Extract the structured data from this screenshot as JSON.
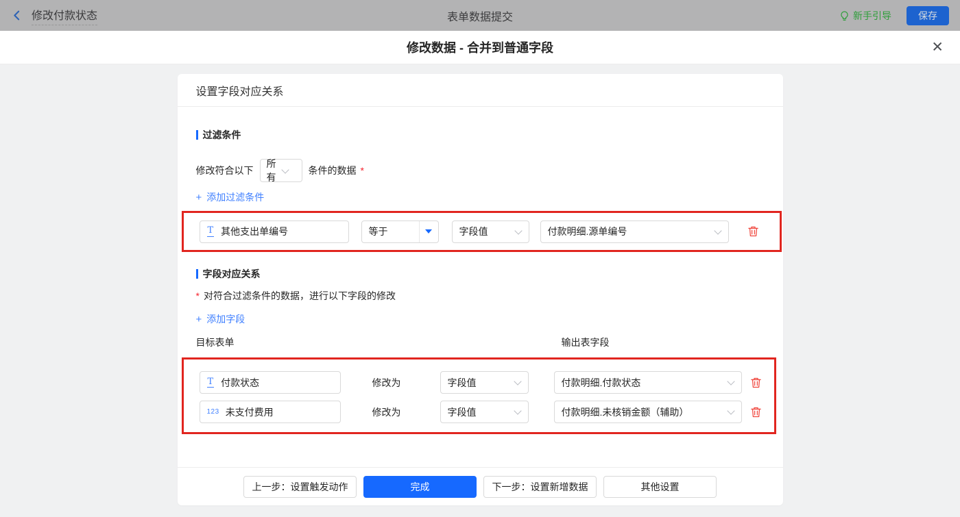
{
  "topbar": {
    "back_label": "修改付款状态",
    "center_title": "表单数据提交",
    "guide_label": "新手引导",
    "save_label": "保存"
  },
  "dialog": {
    "title": "修改数据 - 合并到普通字段",
    "close_glyph": "✕"
  },
  "card": {
    "header_title": "设置字段对应关系"
  },
  "filter": {
    "section_title": "过滤条件",
    "match_prefix": "修改符合以下",
    "match_value": "所有",
    "match_suffix": "条件的数据",
    "required_mark": "*",
    "plus": "+",
    "add_label": "添加过滤条件",
    "row": {
      "field_icon": "T",
      "field": "其他支出单编号",
      "operator": "等于",
      "value_type": "字段值",
      "value": "付款明细.源单编号"
    }
  },
  "mapping": {
    "section_title": "字段对应关系",
    "required_mark": "*",
    "description": "对符合过滤条件的数据，进行以下字段的修改",
    "plus": "+",
    "add_label": "添加字段",
    "col_target": "目标表单",
    "col_output": "输出表字段",
    "rows": [
      {
        "icon": "T",
        "field": "付款状态",
        "action": "修改为",
        "value_type": "字段值",
        "value": "付款明细.付款状态"
      },
      {
        "icon": "123",
        "field": "未支付费用",
        "action": "修改为",
        "value_type": "字段值",
        "value": "付款明细.未核销金额（辅助）"
      }
    ]
  },
  "footer": {
    "prev_label": "上一步：设置触发动作",
    "done_label": "完成",
    "next_label": "下一步：设置新增数据",
    "other_label": "其他设置"
  },
  "colors": {
    "accent_blue": "#1669ff",
    "link_blue": "#4080ff",
    "annotation_red": "#e1251f",
    "trash_red": "#f0483f",
    "guide_green": "#2f9e3a",
    "asterisk_red": "#f5222d",
    "topbar_gray": "#b3b3b4",
    "page_gray": "#f0f1f2"
  }
}
